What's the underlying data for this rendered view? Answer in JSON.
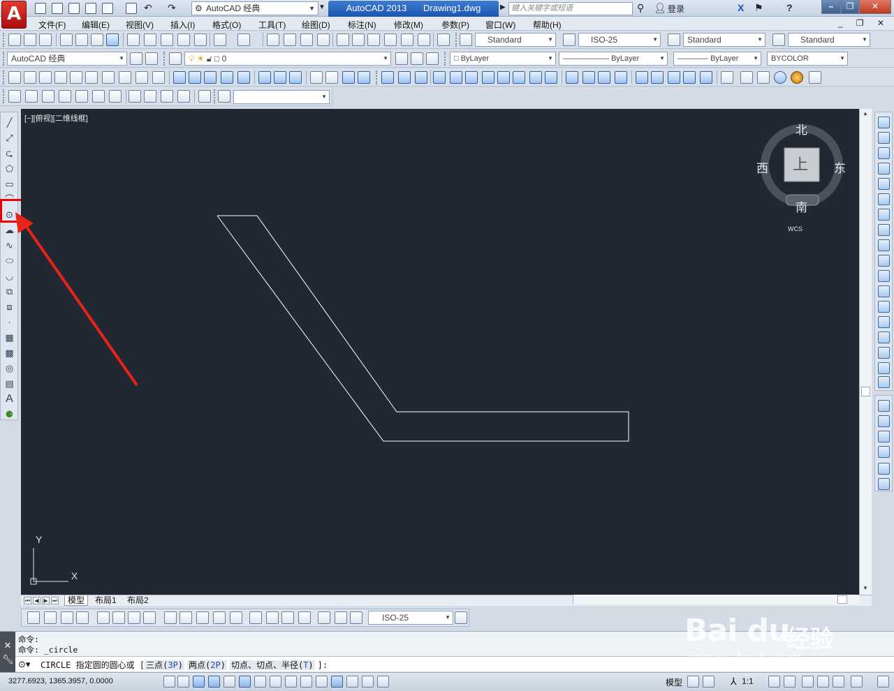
{
  "titlebar": {
    "app_logo": "A",
    "workspace": "AutoCAD 经典",
    "app_name": "AutoCAD 2013",
    "doc_name": "Drawing1.dwg",
    "search_placeholder": "键入关键字或短语",
    "login": "登录",
    "help": "?"
  },
  "menu": {
    "items": [
      "文件(F)",
      "编辑(E)",
      "视图(V)",
      "插入(I)",
      "格式(O)",
      "工具(T)",
      "绘图(D)",
      "标注(N)",
      "修改(M)",
      "参数(P)",
      "窗口(W)",
      "帮助(H)"
    ]
  },
  "styles_toolbar": {
    "text_style": "Standard",
    "dim_style": "ISO-25",
    "table_style": "Standard",
    "mleader_style": "Standard"
  },
  "layers_toolbar": {
    "workspace": "AutoCAD 经典",
    "layer": "0",
    "color": "ByLayer",
    "linetype": "ByLayer",
    "lineweight": "ByLayer",
    "plotstyle": "BYCOLOR"
  },
  "viewport": {
    "label": "[−][俯视][二维线框]",
    "viewcube": {
      "north": "北",
      "south": "南",
      "east": "东",
      "west": "西",
      "face": "上",
      "wcs": "WCS"
    },
    "ucs": {
      "x": "X",
      "y": "Y"
    }
  },
  "layout_tabs": [
    "模型",
    "布局1",
    "布局2"
  ],
  "dim_toolbar": {
    "dim_style": "ISO-25"
  },
  "command": {
    "history": [
      "命令:",
      "命令: _circle"
    ],
    "prompt_cmd": "CIRCLE",
    "prompt_text": "指定圆的圆心或",
    "options": [
      {
        "label": "三点",
        "key": "3P"
      },
      {
        "label": "两点",
        "key": "2P"
      },
      {
        "label": "切点、切点、半径",
        "key": "T"
      }
    ],
    "prompt_end": "]:"
  },
  "statusbar": {
    "coords": "3277.6923, 1365.3957, 0.0000",
    "model": "模型",
    "scale": "1:1"
  },
  "watermark": {
    "logo": "Bai du",
    "cn": "经验",
    "url": "jingyan.baidu.com"
  },
  "colors": {
    "viewport_bg": "#222831",
    "geometry": "#ffffff",
    "highlight": "#f00000",
    "arrow": "#e8231a"
  }
}
